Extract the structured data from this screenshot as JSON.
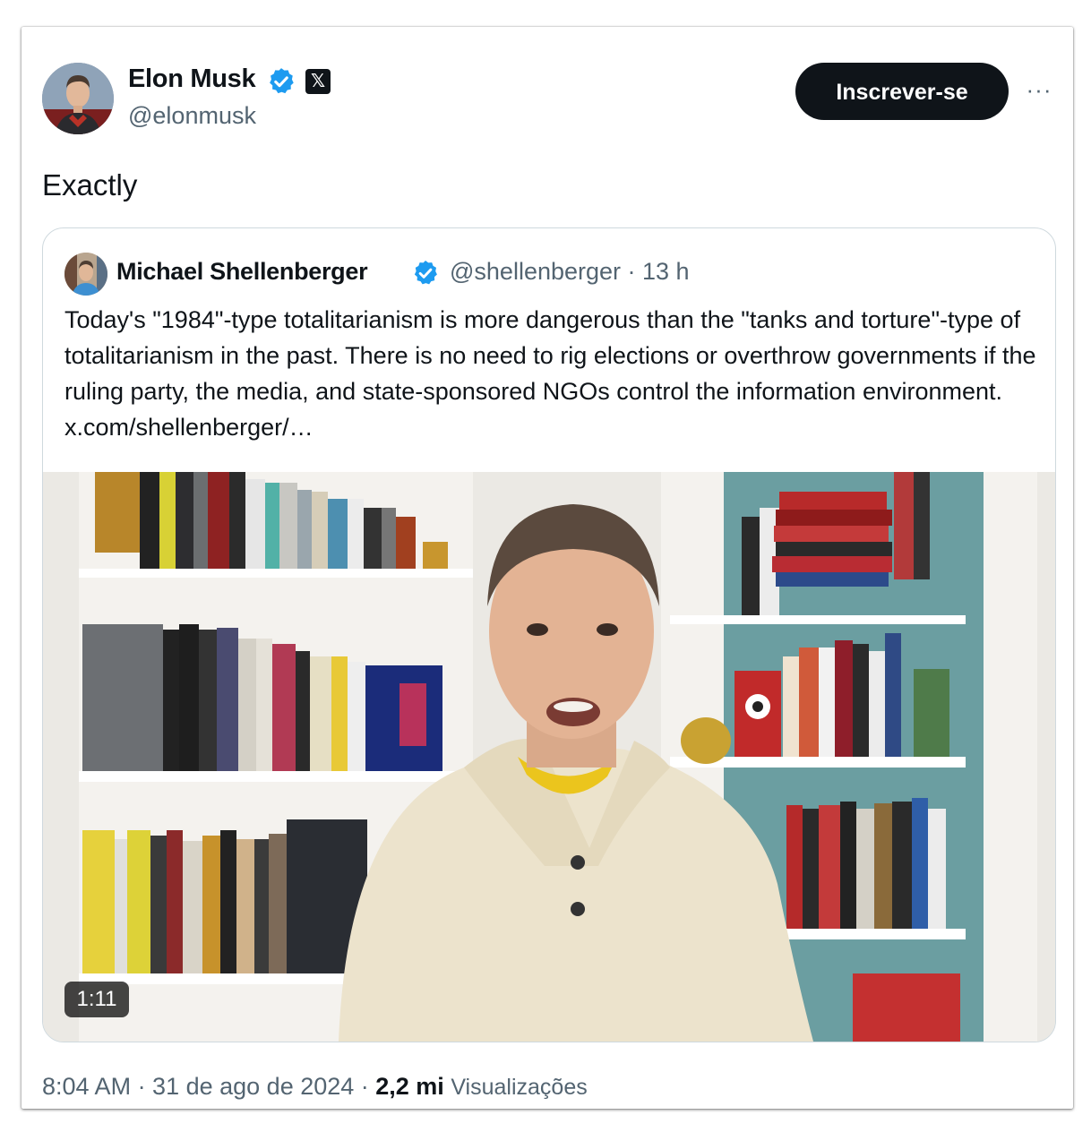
{
  "post": {
    "author": {
      "name": "Elon Musk",
      "handle": "@elonmusk",
      "verified_icon": "verified-badge-icon",
      "affiliation_icon": "x-logo-icon",
      "affiliation_badge": "𝕏"
    },
    "subscribe_label": "Inscrever-se",
    "more_icon": "more-horizontal-icon",
    "more_glyph": "···",
    "text": "Exactly",
    "quoted": {
      "author": {
        "name": "Michael Shellenberger",
        "handle_and_time": "@shellenberger · 13 h",
        "verified_icon": "verified-badge-icon"
      },
      "text": "Today's \"1984\"-type totalitarianism is more dangerous than the \"tanks and torture\"-type of totalitarianism in the past. There is no need to rig elections or overthrow governments if the ruling party,  the media, and state-sponsored NGOs control the information environment.  x.com/shellenberger/…",
      "video": {
        "duration": "1:11"
      }
    },
    "timestamp": "8:04 AM · 31 de ago de 2024 · ",
    "views_count": "2,2 mi",
    "views_label": "Visualizações"
  },
  "colors": {
    "text_primary": "#0f1419",
    "text_secondary": "#536471",
    "verified_blue": "#1d9bf0",
    "button_bg": "#0f1419",
    "border": "#cfd9de"
  }
}
